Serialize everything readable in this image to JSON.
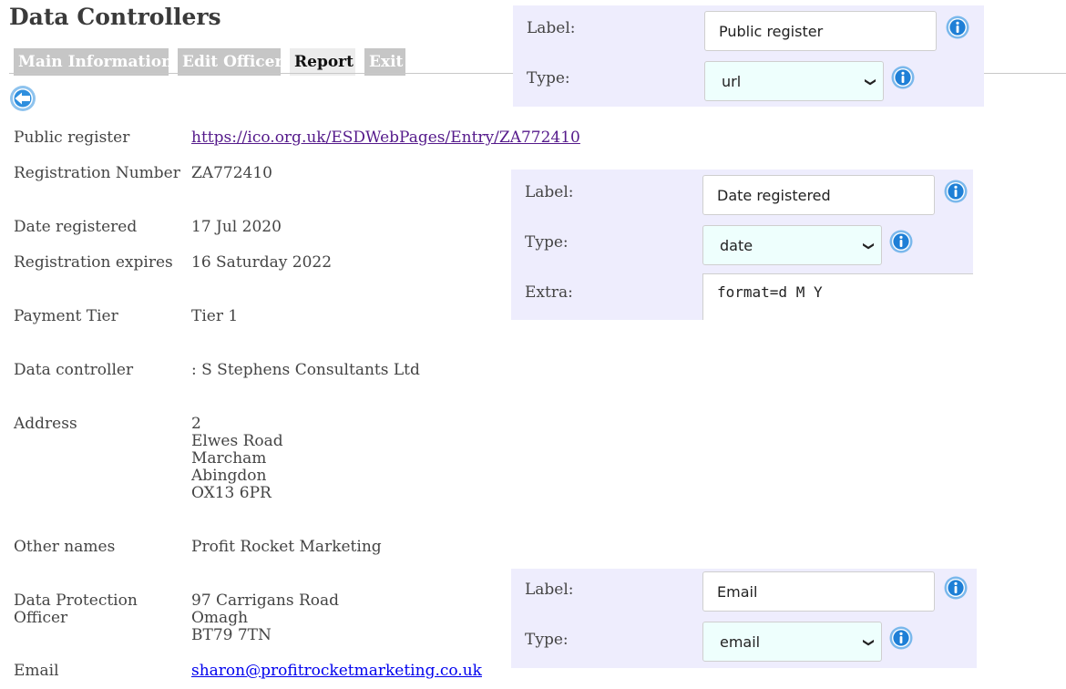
{
  "page": {
    "title": "Data Controllers"
  },
  "tabs": [
    {
      "label": "Main Information",
      "active": false
    },
    {
      "label": "Edit Officer",
      "active": false
    },
    {
      "label": "Report",
      "active": true
    },
    {
      "label": "Exit",
      "active": false
    }
  ],
  "icons": {
    "back": "back-arrow-icon",
    "info": "info-icon"
  },
  "colors": {
    "panel_bg": "#eeedfd",
    "select_bg": "#eefffd",
    "icon_blue": "#1e7fd6",
    "link": "#551a8b"
  },
  "details": {
    "public_register": {
      "label": "Public register",
      "value": "https://ico.org.uk/ESDWebPages/Entry/ZA772410"
    },
    "registration_number": {
      "label": "Registration Number",
      "value": "ZA772410"
    },
    "date_registered": {
      "label": "Date registered",
      "value": "17 Jul 2020"
    },
    "registration_expires": {
      "label": "Registration expires",
      "value": "16 Saturday 2022"
    },
    "payment_tier": {
      "label": "Payment Tier",
      "value": "Tier 1"
    },
    "data_controller": {
      "label": "Data controller",
      "value": ": S Stephens Consultants Ltd"
    },
    "address": {
      "label": "Address",
      "lines": [
        "2",
        "Elwes Road",
        "Marcham",
        "Abingdon",
        "OX13 6PR"
      ]
    },
    "other_names": {
      "label": "Other names",
      "value": "Profit Rocket Marketing"
    },
    "dpo": {
      "label_lines": [
        "Data Protection",
        "Officer"
      ],
      "lines": [
        "97 Carrigans Road",
        "Omagh",
        "BT79 7TN"
      ]
    },
    "email": {
      "label": "Email",
      "value": "sharon@profitrocketmarketing.co.uk"
    }
  },
  "panels": {
    "public_register": {
      "label_caption": "Label:",
      "label_value": "Public register",
      "type_caption": "Type:",
      "type_value": "url"
    },
    "date_registered": {
      "label_caption": "Label:",
      "label_value": "Date registered",
      "type_caption": "Type:",
      "type_value": "date",
      "extra_caption": "Extra:",
      "extra_value": "format=d M Y"
    },
    "email": {
      "label_caption": "Label:",
      "label_value": "Email",
      "type_caption": "Type:",
      "type_value": "email"
    }
  }
}
